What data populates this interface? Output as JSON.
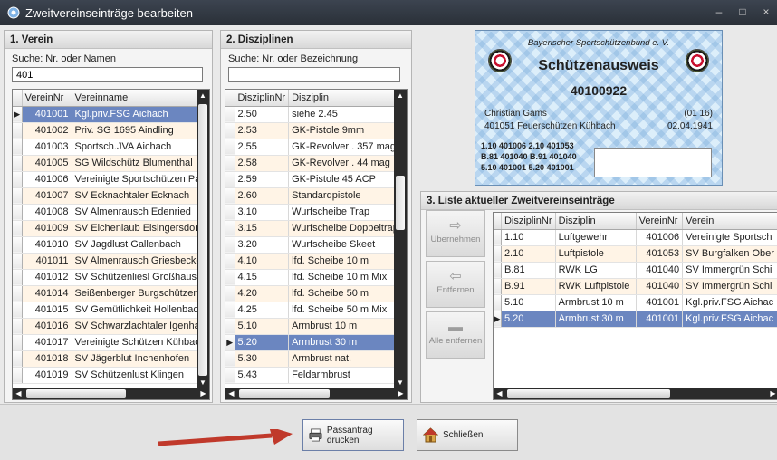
{
  "window": {
    "title": "Zweitvereinseinträge bearbeiten",
    "controls": [
      "–",
      "□",
      "×"
    ]
  },
  "verein": {
    "title": "1. Verein",
    "search_label": "Suche: Nr. oder Namen",
    "search_value": "401",
    "columns": [
      "VereinNr",
      "Vereinname"
    ],
    "rows": [
      [
        "401001",
        "Kgl.priv.FSG Aichach"
      ],
      [
        "401002",
        "Priv. SG 1695 Aindling"
      ],
      [
        "401003",
        "Sportsch.JVA Aichach"
      ],
      [
        "401005",
        "SG Wildschütz Blumenthal"
      ],
      [
        "401006",
        "Vereinigte Sportschützen Pa"
      ],
      [
        "401007",
        "SV Ecknachtaler Ecknach"
      ],
      [
        "401008",
        "SV Almenrausch Edenried"
      ],
      [
        "401009",
        "SV Eichenlaub Eisingersdorf"
      ],
      [
        "401010",
        "SV Jagdlust Gallenbach"
      ],
      [
        "401011",
        "SV Almenrausch Griesbecke"
      ],
      [
        "401012",
        "SV Schützenliesl Großhause"
      ],
      [
        "401014",
        "Seißenberger Burgschützen"
      ],
      [
        "401015",
        "SV Gemütlichkeit Hollenbac"
      ],
      [
        "401016",
        "SV Schwarzlachtaler Igenha"
      ],
      [
        "401017",
        "Vereinigte Schützen Kühbac"
      ],
      [
        "401018",
        "SV Jägerblut Inchenhofen"
      ],
      [
        "401019",
        "SV Schützenlust Klingen"
      ]
    ]
  },
  "disziplinen": {
    "title": "2. Disziplinen",
    "search_label": "Suche: Nr. oder Bezeichnung",
    "search_value": "",
    "columns": [
      "DisziplinNr",
      "Disziplin"
    ],
    "rows": [
      [
        "2.50",
        "siehe 2.45"
      ],
      [
        "2.53",
        "GK-Pistole 9mm"
      ],
      [
        "2.55",
        "GK-Revolver . 357 mag"
      ],
      [
        "2.58",
        "GK-Revolver . 44 mag"
      ],
      [
        "2.59",
        "GK-Pistole 45 ACP"
      ],
      [
        "2.60",
        "Standardpistole"
      ],
      [
        "3.10",
        "Wurfscheibe Trap"
      ],
      [
        "3.15",
        "Wurfscheibe Doppeltrap"
      ],
      [
        "3.20",
        "Wurfscheibe Skeet"
      ],
      [
        "4.10",
        "lfd. Scheibe 10 m"
      ],
      [
        "4.15",
        "lfd. Scheibe 10 m Mix"
      ],
      [
        "4.20",
        "lfd. Scheibe 50 m"
      ],
      [
        "4.25",
        "lfd. Scheibe 50 m Mix"
      ],
      [
        "5.10",
        "Armbrust 10 m"
      ],
      [
        "5.20",
        "Armbrust 30 m"
      ],
      [
        "5.30",
        "Armbrust nat."
      ],
      [
        "5.43",
        "Feldarmbrust"
      ]
    ]
  },
  "ausweis": {
    "org": "Bayerischer Sportschützenbund e. V.",
    "heading": "Schützenausweis",
    "number": "40100922",
    "name": "Christian Gams",
    "code": "(01 16)",
    "club": "401051 Feuerschützen Kühbach",
    "birthdate": "02.04.1941",
    "disc_lines": [
      "1.10 401006 2.10 401053",
      "B.81 401040 B.91 401040",
      "5.10 401001 5.20 401001"
    ]
  },
  "liste": {
    "title": "3. Liste aktueller Zweitvereinseinträge",
    "columns": [
      "DisziplinNr",
      "Disziplin",
      "VereinNr",
      "Verein"
    ],
    "rows": [
      [
        "1.10",
        "Luftgewehr",
        "401006",
        "Vereinigte Sportsch"
      ],
      [
        "2.10",
        "Luftpistole",
        "401053",
        "SV Burgfalken Ober"
      ],
      [
        "B.81",
        "RWK LG",
        "401040",
        "SV Immergrün Schi"
      ],
      [
        "B.91",
        "RWK Luftpistole",
        "401040",
        "SV Immergrün Schi"
      ],
      [
        "5.10",
        "Armbrust 10 m",
        "401001",
        "Kgl.priv.FSG Aichac"
      ],
      [
        "5.20",
        "Armbrust 30 m",
        "401001",
        "Kgl.priv.FSG Aichac"
      ]
    ]
  },
  "actions": {
    "uebernehmen": "Übernehmen",
    "entfernen": "Entfernen",
    "alle_entfernen": "Alle entfernen"
  },
  "footer": {
    "print": "Passantrag drucken",
    "close": "Schließen"
  },
  "colors": {
    "selection": "#6b86c0",
    "alt_row": "#fff4e6",
    "annotation_arrow": "#c0392b"
  }
}
